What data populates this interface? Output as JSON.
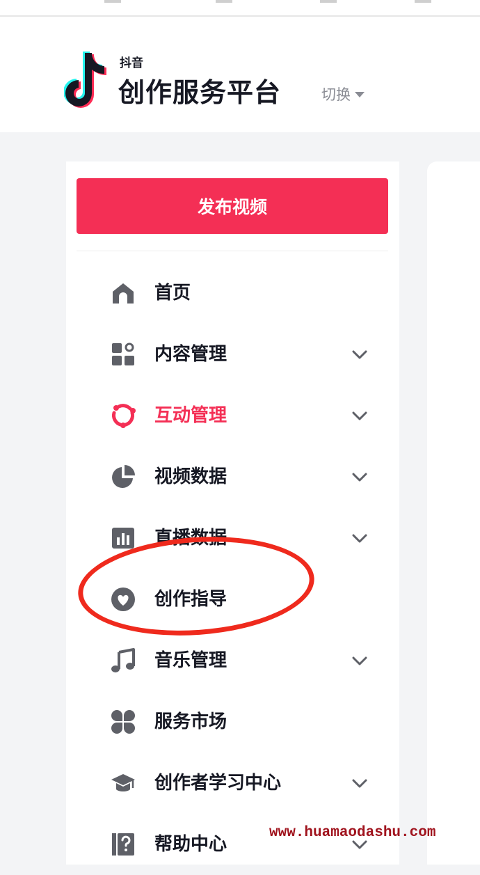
{
  "header": {
    "logo_small": "抖音",
    "title": "创作服务平台",
    "switch_label": "切换"
  },
  "sidebar": {
    "publish_label": "发布视频",
    "items": [
      {
        "label": "首页",
        "icon": "home-icon",
        "expandable": false,
        "active": false
      },
      {
        "label": "内容管理",
        "icon": "content-grid-icon",
        "expandable": true,
        "active": false
      },
      {
        "label": "互动管理",
        "icon": "interaction-icon",
        "expandable": true,
        "active": true
      },
      {
        "label": "视频数据",
        "icon": "pie-chart-icon",
        "expandable": true,
        "active": false
      },
      {
        "label": "直播数据",
        "icon": "bar-chart-icon",
        "expandable": true,
        "active": false
      },
      {
        "label": "创作指导",
        "icon": "heart-icon",
        "expandable": false,
        "active": false
      },
      {
        "label": "音乐管理",
        "icon": "music-note-icon",
        "expandable": true,
        "active": false
      },
      {
        "label": "服务市场",
        "icon": "clover-icon",
        "expandable": false,
        "active": false
      },
      {
        "label": "创作者学习中心",
        "icon": "graduation-cap-icon",
        "expandable": true,
        "active": false
      },
      {
        "label": "帮助中心",
        "icon": "help-icon",
        "expandable": true,
        "active": false
      }
    ]
  },
  "watermark": "www.huamaodashu.com",
  "colors": {
    "accent": "#f42f55",
    "text": "#161823",
    "icon": "#5e6067",
    "annotation": "#ef2a1d"
  }
}
